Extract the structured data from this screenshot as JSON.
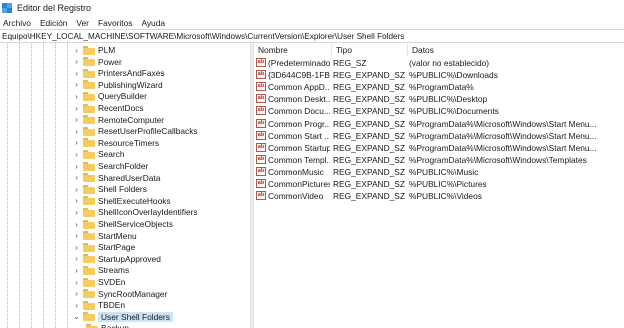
{
  "window": {
    "title": "Editor del Registro"
  },
  "menu": [
    "Archivo",
    "Edición",
    "Ver",
    "Favoritos",
    "Ayuda"
  ],
  "address": "Equipo\\HKEY_LOCAL_MACHINE\\SOFTWARE\\Microsoft\\Windows\\CurrentVersion\\Explorer\\User Shell Folders",
  "tree": {
    "items": [
      {
        "label": "PLM",
        "expandable": true
      },
      {
        "label": "Power",
        "expandable": true
      },
      {
        "label": "PrintersAndFaxes",
        "expandable": true
      },
      {
        "label": "PublishingWizard",
        "expandable": true
      },
      {
        "label": "QueryBuilder",
        "expandable": true
      },
      {
        "label": "RecentDocs",
        "expandable": true
      },
      {
        "label": "RemoteComputer",
        "expandable": true
      },
      {
        "label": "ResetUserProfileCallbacks",
        "expandable": true
      },
      {
        "label": "ResourceTimers",
        "expandable": true
      },
      {
        "label": "Search",
        "expandable": true
      },
      {
        "label": "SearchFolder",
        "expandable": true
      },
      {
        "label": "SharedUserData",
        "expandable": true
      },
      {
        "label": "Shell Folders",
        "expandable": true
      },
      {
        "label": "ShellExecuteHooks",
        "expandable": true
      },
      {
        "label": "ShellIconOverlayIdentifiers",
        "expandable": true
      },
      {
        "label": "ShellServiceObjects",
        "expandable": true
      },
      {
        "label": "StartMenu",
        "expandable": true
      },
      {
        "label": "StartPage",
        "expandable": true
      },
      {
        "label": "StartupApproved",
        "expandable": true
      },
      {
        "label": "Streams",
        "expandable": true
      },
      {
        "label": "SVDEn",
        "expandable": true
      },
      {
        "label": "SyncRootManager",
        "expandable": true
      },
      {
        "label": "TBDEn",
        "expandable": true
      },
      {
        "label": "User Shell Folders",
        "expandable": true,
        "expanded": true,
        "selected": true
      }
    ],
    "child": {
      "label": "Backup"
    }
  },
  "list": {
    "columns": {
      "name": "Nombre",
      "type": "Tipo",
      "data": "Datos"
    },
    "rows": [
      {
        "name": "(Predeterminado)",
        "type": "REG_SZ",
        "data": "(valor no establecido)"
      },
      {
        "name": "{3D644C9B-1FB8...",
        "type": "REG_EXPAND_SZ",
        "data": "%PUBLIC%\\Downloads"
      },
      {
        "name": "Common AppD...",
        "type": "REG_EXPAND_SZ",
        "data": "%ProgramData%"
      },
      {
        "name": "Common Deskt...",
        "type": "REG_EXPAND_SZ",
        "data": "%PUBLIC%\\Desktop"
      },
      {
        "name": "Common Docu...",
        "type": "REG_EXPAND_SZ",
        "data": "%PUBLIC%\\Documents"
      },
      {
        "name": "Common Progr...",
        "type": "REG_EXPAND_SZ",
        "data": "%ProgramData%\\Microsoft\\Windows\\Start Menu..."
      },
      {
        "name": "Common Start ...",
        "type": "REG_EXPAND_SZ",
        "data": "%ProgramData%\\Microsoft\\Windows\\Start Menu..."
      },
      {
        "name": "Common Startup",
        "type": "REG_EXPAND_SZ",
        "data": "%ProgramData%\\Microsoft\\Windows\\Start Menu..."
      },
      {
        "name": "Common Templ...",
        "type": "REG_EXPAND_SZ",
        "data": "%ProgramData%\\Microsoft\\Windows\\Templates"
      },
      {
        "name": "CommonMusic",
        "type": "REG_EXPAND_SZ",
        "data": "%PUBLIC%\\Music"
      },
      {
        "name": "CommonPictures",
        "type": "REG_EXPAND_SZ",
        "data": "%PUBLIC%\\Pictures"
      },
      {
        "name": "CommonVideo",
        "type": "REG_EXPAND_SZ",
        "data": "%PUBLIC%\\Videos"
      }
    ]
  },
  "icons": {
    "string_value": "ab",
    "expand_collapsed": "›",
    "expand_open": "⌄"
  },
  "colors": {
    "selection": "#cce4f7",
    "folder": "#f4cd5e",
    "app_icon": "#2f7fd6"
  }
}
